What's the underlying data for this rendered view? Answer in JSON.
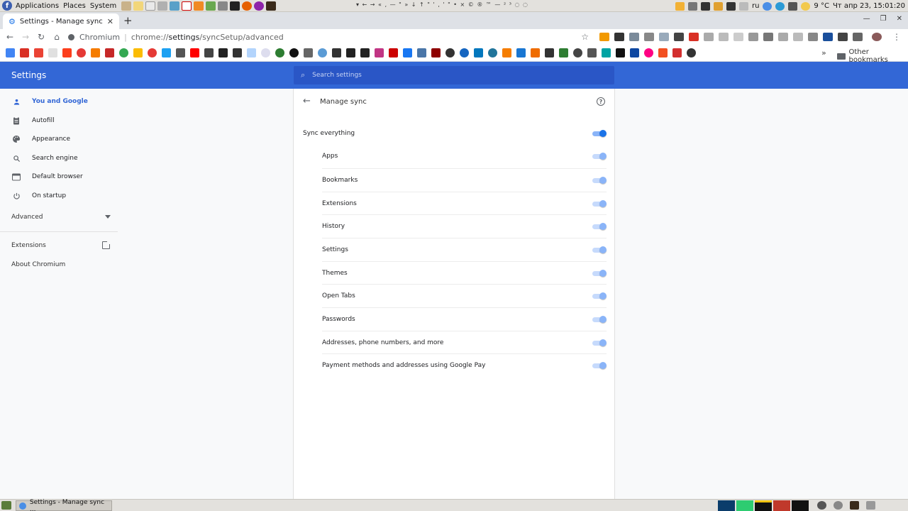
{
  "system_panel": {
    "menus": [
      "Applications",
      "Places",
      "System"
    ],
    "keys_row": "▾ ← → « ‚ — \" » ↓ ↑ \" ' ‚ ' \" • × © ® ™ — ² ³ ◌ ◌",
    "lang": "ru",
    "weather": "9 °C",
    "datetime": "Чт апр 23, 15:01:20"
  },
  "browser": {
    "tab_title": "Settings - Manage sync",
    "new_tab_symbol": "+",
    "omnibox_brand": "Chromium",
    "url_prefix": "chrome://",
    "url_host": "settings",
    "url_path": "/syncSetup/advanced",
    "bookmarks_more": "»",
    "other_bookmarks": "Other bookmarks"
  },
  "settings": {
    "title": "Settings",
    "search_placeholder": "Search settings",
    "sidebar": {
      "items": [
        {
          "label": "You and Google",
          "icon": "person-icon",
          "active": true
        },
        {
          "label": "Autofill",
          "icon": "clipboard-icon",
          "active": false
        },
        {
          "label": "Appearance",
          "icon": "palette-icon",
          "active": false
        },
        {
          "label": "Search engine",
          "icon": "search-icon",
          "active": false
        },
        {
          "label": "Default browser",
          "icon": "browser-window-icon",
          "active": false
        },
        {
          "label": "On startup",
          "icon": "power-icon",
          "active": false
        }
      ],
      "advanced": "Advanced",
      "extensions": "Extensions",
      "about": "About Chromium"
    },
    "manage_sync": {
      "title": "Manage sync",
      "sync_everything": {
        "label": "Sync everything",
        "on": true
      },
      "items": [
        {
          "label": "Apps",
          "on": true
        },
        {
          "label": "Bookmarks",
          "on": true
        },
        {
          "label": "Extensions",
          "on": true
        },
        {
          "label": "History",
          "on": true
        },
        {
          "label": "Settings",
          "on": true
        },
        {
          "label": "Themes",
          "on": true
        },
        {
          "label": "Open Tabs",
          "on": true
        },
        {
          "label": "Passwords",
          "on": true
        },
        {
          "label": "Addresses, phone numbers, and more",
          "on": true
        },
        {
          "label": "Payment methods and addresses using Google Pay",
          "on": true
        }
      ]
    }
  },
  "taskbar": {
    "window_button": "Settings - Manage sync ..."
  },
  "colors": {
    "accent": "#3367d6",
    "toggle_on": "#1a73e8",
    "toggle_disabled": "#8ab4f8"
  }
}
